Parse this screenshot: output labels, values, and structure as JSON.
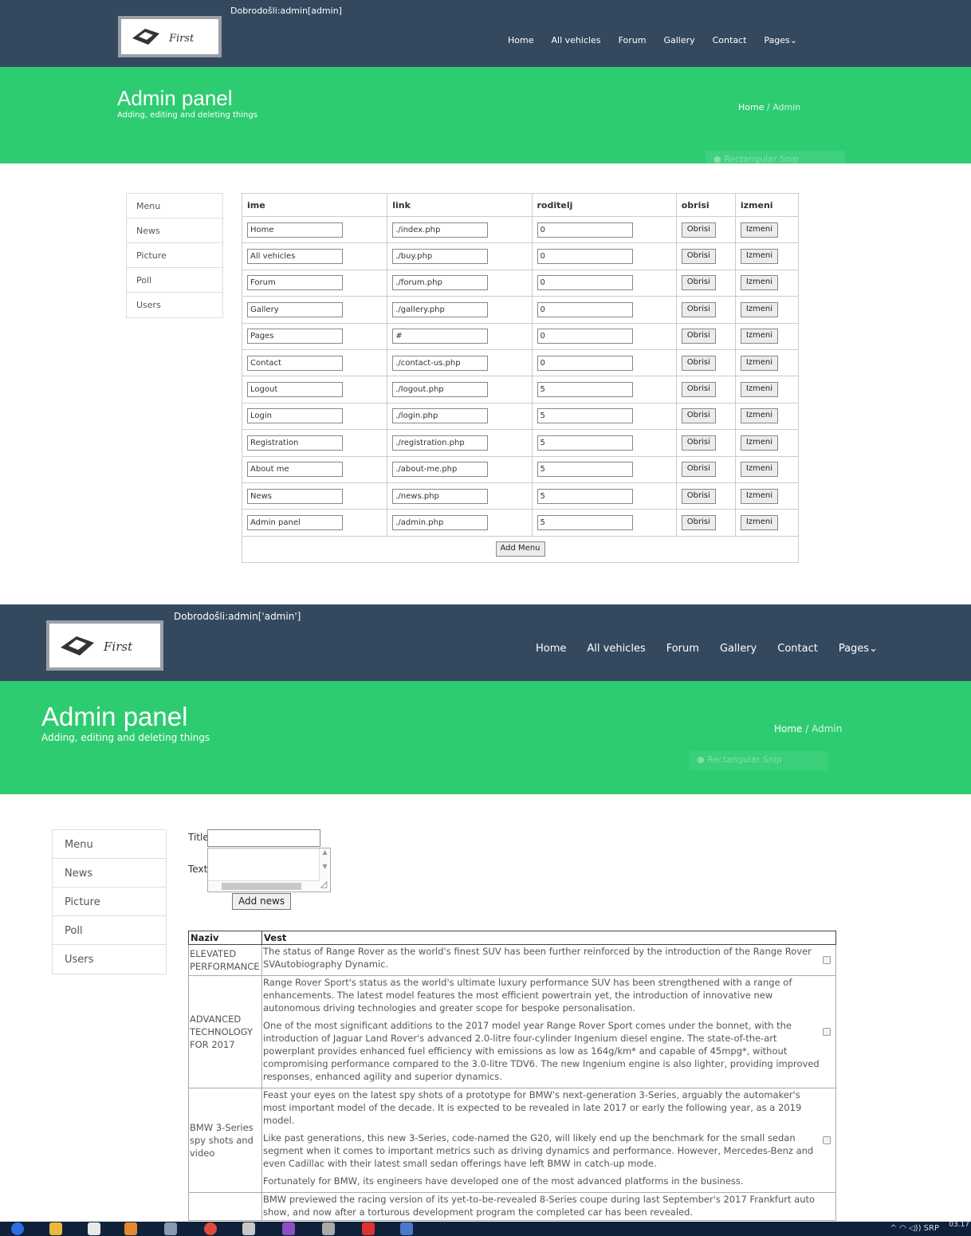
{
  "s1": {
    "welcome": "Dobrodošli:admin[admin]",
    "logo_text": "First",
    "nav": [
      "Home",
      "All vehicles",
      "Forum",
      "Gallery",
      "Contact",
      "Pages⌄"
    ],
    "hero_title": "Admin panel",
    "hero_sub": "Adding, editing and deleting things",
    "crumb_home": "Home",
    "crumb_sep": " / ",
    "crumb_current": "Admin",
    "snip": "Rectangular Snip",
    "sidebar": [
      "Menu",
      "News",
      "Picture",
      "Poll",
      "Users"
    ],
    "table": {
      "headers": [
        "ime",
        "link",
        "roditelj",
        "obrisi",
        "izmeni"
      ],
      "rows": [
        {
          "ime": "Home",
          "link": "./index.php",
          "roditelj": "0"
        },
        {
          "ime": "All vehicles",
          "link": "./buy.php",
          "roditelj": "0"
        },
        {
          "ime": "Forum",
          "link": "./forum.php",
          "roditelj": "0"
        },
        {
          "ime": "Gallery",
          "link": "./gallery.php",
          "roditelj": "0"
        },
        {
          "ime": "Pages",
          "link": "#",
          "roditelj": "0"
        },
        {
          "ime": "Contact",
          "link": "./contact-us.php",
          "roditelj": "0"
        },
        {
          "ime": "Logout",
          "link": "./logout.php",
          "roditelj": "5"
        },
        {
          "ime": "Login",
          "link": "./login.php",
          "roditelj": "5"
        },
        {
          "ime": "Registration",
          "link": "./registration.php",
          "roditelj": "5"
        },
        {
          "ime": "About me",
          "link": "./about-me.php",
          "roditelj": "5"
        },
        {
          "ime": "News",
          "link": "./news.php",
          "roditelj": "5"
        },
        {
          "ime": "Admin panel",
          "link": "./admin.php",
          "roditelj": "5"
        }
      ],
      "delete_label": "Obrisi",
      "edit_label": "Izmeni",
      "add_label": "Add Menu"
    }
  },
  "s2": {
    "welcome": "Dobrodošli:admin['admin']",
    "logo_text": "First",
    "nav": [
      "Home",
      "All vehicles",
      "Forum",
      "Gallery",
      "Contact",
      "Pages⌄"
    ],
    "hero_title": "Admin panel",
    "hero_sub": "Adding, editing and deleting things",
    "crumb_home": "Home",
    "crumb_sep": " / ",
    "crumb_current": "Admin",
    "snip": "Rectangular Snip",
    "sidebar": [
      "Menu",
      "News",
      "Picture",
      "Poll",
      "Users"
    ],
    "form": {
      "title_label": "Title",
      "text_label": "Text",
      "add_label": "Add news"
    },
    "news": {
      "headers": [
        "Naziv",
        "Vest"
      ],
      "rows": [
        {
          "naziv": "ELEVATED PERFORMANCE",
          "vest": [
            "The status of Range Rover as the world's finest SUV has been further reinforced by the introduction of the Range Rover SVAutobiography Dynamic."
          ]
        },
        {
          "naziv": "ADVANCED TECHNOLOGY FOR 2017",
          "vest": [
            "Range Rover Sport's status as the world's ultimate luxury performance SUV has been strengthened with a range of enhancements. The latest model features the most efficient powertrain yet, the introduction of innovative new autonomous driving technologies and greater scope for bespoke personalisation.",
            "One of the most significant additions to the 2017 model year Range Rover Sport comes under the bonnet, with the introduction of Jaguar Land Rover's advanced 2.0-litre four-cylinder Ingenium diesel engine. The state-of-the-art powerplant provides enhanced fuel efficiency with emissions as low as 164g/km* and capable of 45mpg*, without compromising performance compared to the 3.0-litre TDV6. The new Ingenium engine is also lighter, providing improved responses, enhanced agility and superior dynamics."
          ]
        },
        {
          "naziv": "BMW 3-Series spy shots and video",
          "vest": [
            "Feast your eyes on the latest spy shots of a prototype for BMW's next-generation 3-Series, arguably the automaker's most important model of the decade. It is expected to be revealed in late 2017 or early the following year, as a 2019 model.",
            "Like past generations, this new 3-Series, code-named the G20, will likely end up the benchmark for the small sedan segment when it comes to important metrics such as driving dynamics and performance. However, Mercedes-Benz and even Cadillac with their latest small sedan offerings have left BMW in catch-up mode.",
            "Fortunately for BMW, its engineers have developed one of the most advanced platforms in the business."
          ]
        },
        {
          "naziv": "",
          "vest": [
            "BMW previewed the racing version of its yet-to-be-revealed 8-Series coupe during last September's 2017 Frankfurt auto show, and now after a torturous development program the completed car has been revealed."
          ]
        }
      ]
    }
  },
  "taskbar": {
    "lang": "SRP",
    "clock": "03.17"
  },
  "colors": {
    "header": "#34495e",
    "hero": "#2ecc71",
    "taskbar": "#10213a"
  }
}
